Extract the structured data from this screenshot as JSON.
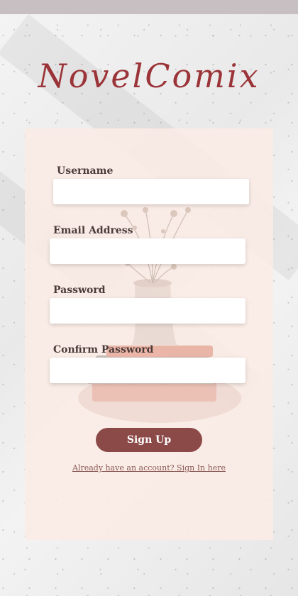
{
  "app": {
    "logo_text": "NovelComix"
  },
  "form": {
    "fields": [
      {
        "label": "Username",
        "value": "",
        "placeholder": ""
      },
      {
        "label": "Email Address",
        "value": "",
        "placeholder": ""
      },
      {
        "label": "Password",
        "value": "",
        "placeholder": ""
      },
      {
        "label": "Confirm Password",
        "value": "",
        "placeholder": ""
      }
    ],
    "submit_label": "Sign Up",
    "signin_link": "Already have an account? Sign In here"
  },
  "colors": {
    "brand": "#9b3438",
    "button": "#8b4a48",
    "card": "#fbeae4",
    "top_bar": "#c7bfc1"
  }
}
